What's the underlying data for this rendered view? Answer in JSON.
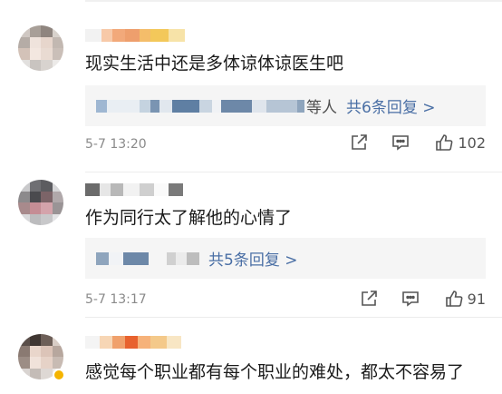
{
  "comments": [
    {
      "text": "现实生活中还是多体谅体谅医生吧",
      "reply_etc": "等人",
      "reply_count": "共6条回复 >",
      "time": "5-7 13:20",
      "likes": "102"
    },
    {
      "text": "作为同行太了解他的心情了",
      "reply_count": "共5条回复 >",
      "time": "5-7 13:17",
      "likes": "91"
    },
    {
      "text": "感觉每个职业都有每个职业的难处，都太不容易了"
    }
  ],
  "colors": {
    "link": "#4a6fa5",
    "reply_bg": "#f5f5f5",
    "meta_text": "#8a8a8a",
    "badge": "#f5b400"
  },
  "icons": [
    "share-icon",
    "comment-icon",
    "like-icon"
  ]
}
